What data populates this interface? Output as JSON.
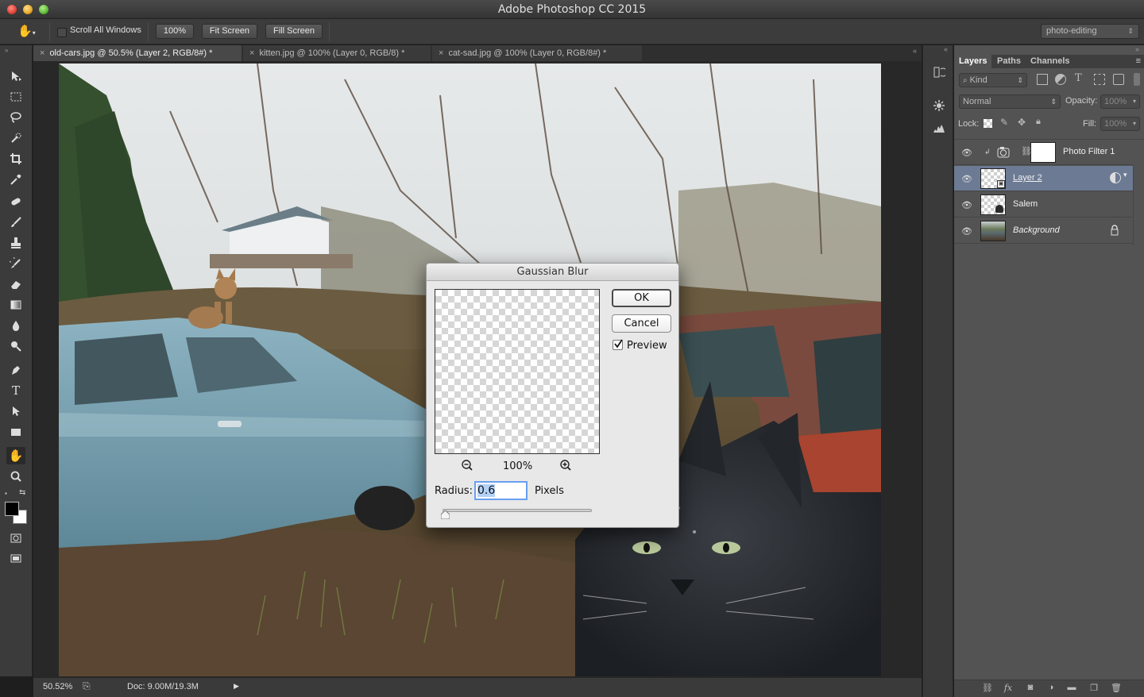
{
  "window": {
    "title": "Adobe Photoshop CC 2015"
  },
  "options": {
    "scroll_all_label": "Scroll All Windows",
    "zoom_100_label": "100%",
    "fit_screen_label": "Fit Screen",
    "fill_screen_label": "Fill Screen",
    "workspace": "photo-editing"
  },
  "tabs": [
    {
      "label": "old-cars.jpg @ 50.5% (Layer 2, RGB/8#) *",
      "close": "×"
    },
    {
      "label": "kitten.jpg @ 100% (Layer 0, RGB/8) *",
      "close": "×"
    },
    {
      "label": "cat-sad.jpg @ 100% (Layer 0, RGB/8#) *",
      "close": "×"
    }
  ],
  "status": {
    "zoom": "50.52%",
    "doc": "Doc: 9.00M/19.3M"
  },
  "layers_panel": {
    "tabs": [
      "Layers",
      "Paths",
      "Channels"
    ],
    "filter": "Kind",
    "blend_mode": "Normal",
    "opacity_label": "Opacity:",
    "opacity_value": "100%",
    "lock_label": "Lock:",
    "fill_label": "Fill:",
    "fill_value": "100%",
    "layers": [
      {
        "name": "Photo Filter 1"
      },
      {
        "name": "Layer 2"
      },
      {
        "name": "Salem"
      },
      {
        "name": "Background"
      }
    ]
  },
  "dialog": {
    "title": "Gaussian Blur",
    "ok_label": "OK",
    "cancel_label": "Cancel",
    "preview_label": "Preview",
    "preview_checked": true,
    "zoom_label": "100%",
    "radius_label": "Radius:",
    "radius_value": "0.6",
    "unit_label": "Pixels"
  },
  "colors": {
    "selected_layer": "#6c7a94",
    "panel_bg": "#535353",
    "toolbar_bg": "#3b3b3b"
  }
}
